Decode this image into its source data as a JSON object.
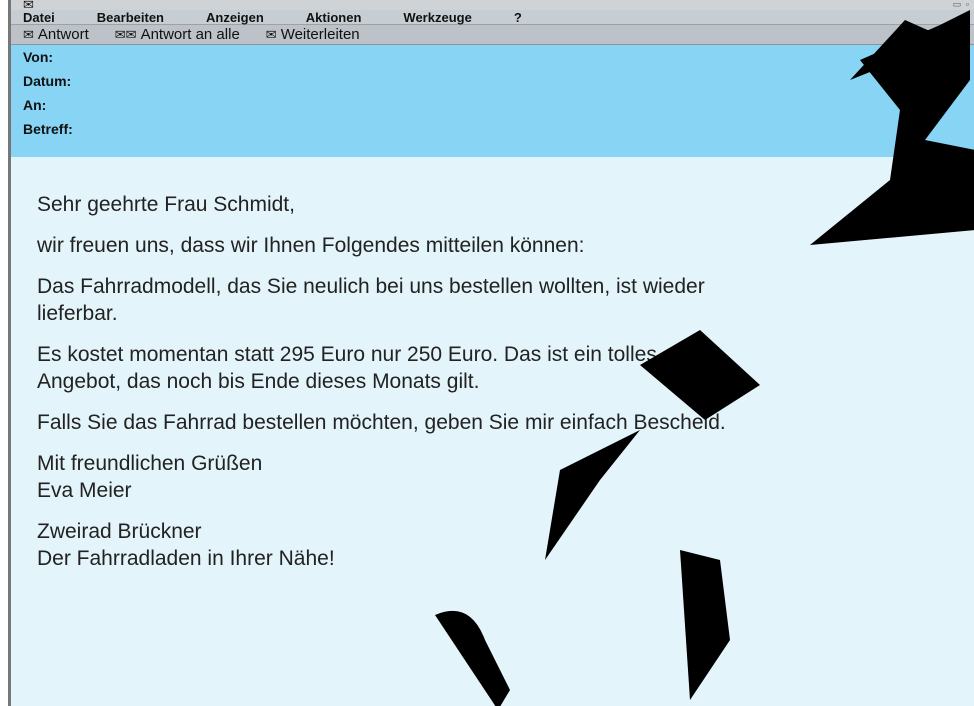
{
  "titlebar": {
    "window_controls": "▭ ▫"
  },
  "menu": [
    "Datei",
    "Bearbeiten",
    "Anzeigen",
    "Aktionen",
    "Werkzeuge",
    "?"
  ],
  "toolbar": {
    "reply": "Antwort",
    "reply_all": "Antwort an alle",
    "forward": "Weiterleiten"
  },
  "header_fields": {
    "from": "Von:",
    "date": "Datum:",
    "to": "An:",
    "subject": "Betreff:"
  },
  "body": {
    "greeting": "Sehr geehrte Frau Schmidt,",
    "intro": "wir freuen uns, dass wir Ihnen Folgendes mitteilen können:",
    "p1_line1": "Das Fahrradmodell, das Sie neulich bei uns bestellen wollten, ist wieder",
    "p1_line2": "lieferbar.",
    "p2_line1": "Es kostet momentan statt 295 Euro nur 250 Euro. Das ist ein tolles",
    "p2_line2": "Angebot, das noch bis Ende dieses Monats gilt.",
    "p3": "Falls Sie das Fahrrad bestellen möchten, geben Sie mir einfach Bescheid.",
    "closing": "Mit freundlichen Grüßen",
    "signature": "Eva Meier",
    "company": "Zweirad Brückner",
    "slogan": "Der Fahrradladen in Ihrer Nähe!"
  },
  "icons": {
    "envelope": "envelope-icon"
  },
  "colors": {
    "header_bg": "#87d4f4",
    "body_bg": "#e3f4fb",
    "stamp": "#000000"
  }
}
